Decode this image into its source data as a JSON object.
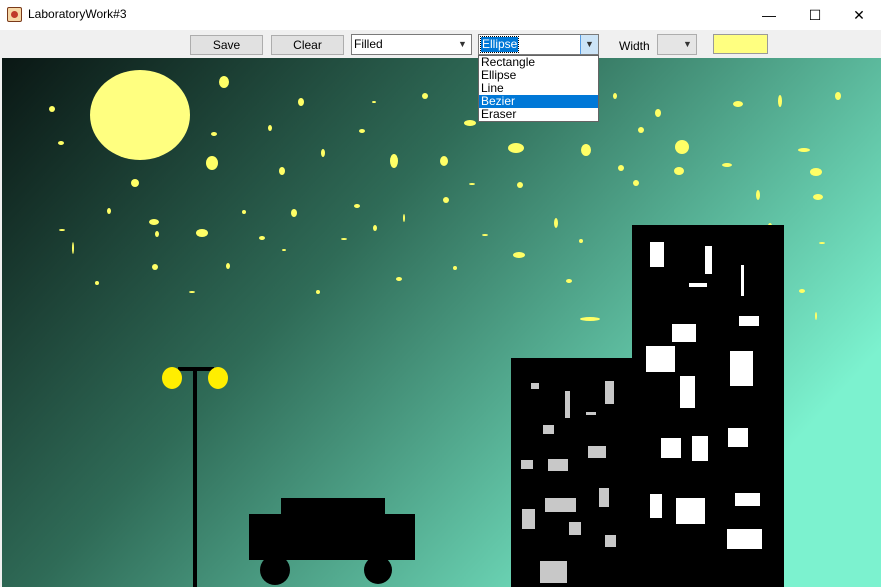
{
  "window": {
    "title": "LaboratoryWork#3",
    "minimize": "—",
    "maximize": "☐",
    "close": "✕"
  },
  "toolbar": {
    "save_label": "Save",
    "clear_label": "Clear",
    "fill_mode": "Filled",
    "shape": "Ellipse",
    "width_label": "Width",
    "width_value": "",
    "color": "#ffff80"
  },
  "shape_options": [
    "Rectangle",
    "Ellipse",
    "Line",
    "Bezier",
    "Eraser"
  ],
  "shape_highlighted": "Bezier",
  "colors": {
    "sky_dark": "#0a1714",
    "sky_light": "#7cf2cf",
    "moon": "#ffff80",
    "star": "#ffff66",
    "lamp": "#ffee00",
    "silhouette": "#000000",
    "window_white": "#ffffff",
    "window_gray": "#c8c8c8"
  }
}
